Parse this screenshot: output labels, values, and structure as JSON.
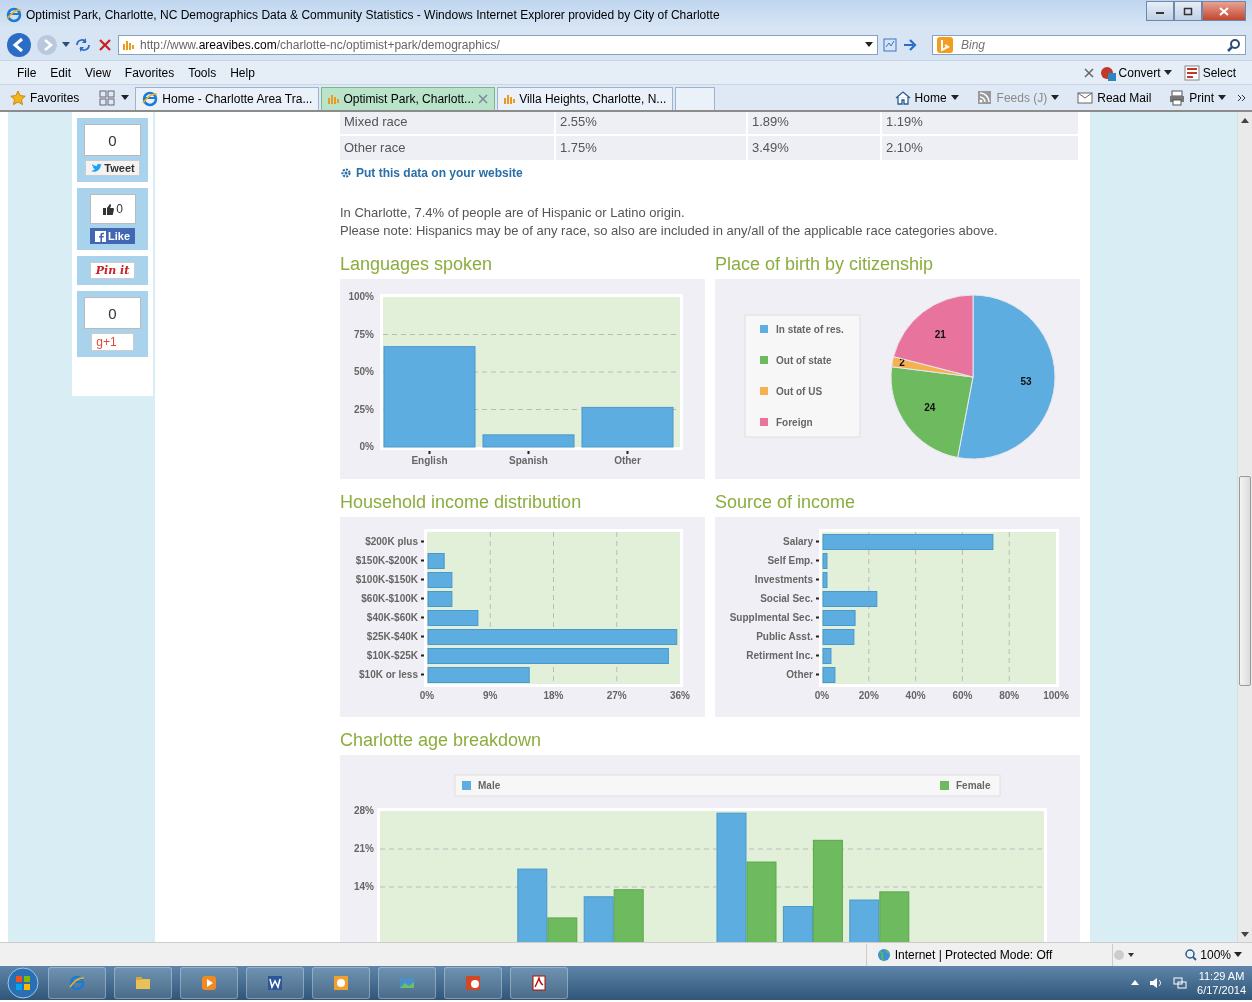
{
  "window": {
    "title": "Optimist Park, Charlotte, NC Demographics Data & Community Statistics - Windows Internet Explorer provided by City of Charlotte"
  },
  "address_bar": {
    "url_prefix": "http://www.",
    "url_domain": "areavibes.com",
    "url_path": "/charlotte-nc/optimist+park/demographics/"
  },
  "search": {
    "placeholder": "Bing"
  },
  "menu": [
    "File",
    "Edit",
    "View",
    "Favorites",
    "Tools",
    "Help"
  ],
  "command_bar": [
    "Convert",
    "Select"
  ],
  "favorites_button": "Favorites",
  "tabs": [
    {
      "label": "Home - Charlotte Area Tra...",
      "selected": false
    },
    {
      "label": "Optimist Park, Charlott...",
      "selected": true
    },
    {
      "label": "Villa Heights, Charlotte, N...",
      "selected": false
    }
  ],
  "toolbar": [
    {
      "label": "Home",
      "disabled": false
    },
    {
      "label": "Feeds (J)",
      "disabled": true
    },
    {
      "label": "Read Mail",
      "disabled": false
    },
    {
      "label": "Print",
      "disabled": false
    }
  ],
  "social": [
    {
      "kind": "tweet",
      "count": "0",
      "label": "Tweet"
    },
    {
      "kind": "like",
      "count": "0",
      "label": "Like"
    },
    {
      "kind": "pin",
      "label": "Pin it"
    },
    {
      "kind": "plusone",
      "count": "0",
      "label": "g+1"
    }
  ],
  "race_table": {
    "rows": [
      [
        "Mixed race",
        "2.55%",
        "1.89%",
        "1.19%"
      ],
      [
        "Other race",
        "1.75%",
        "3.49%",
        "2.10%"
      ]
    ]
  },
  "embed_link": "Put this data on your website",
  "notes": [
    "In Charlotte, 7.4% of people are of Hispanic or Latino origin.",
    "Please note: Hispanics may be of any race, so also are included in any/all of the applicable race categories above."
  ],
  "sections": [
    {
      "title": "Languages spoken",
      "kind": "half",
      "chart_data": {
        "type": "bar",
        "categories": [
          "English",
          "Spanish",
          "Other"
        ],
        "values": [
          66.9,
          8.1,
          26.4
        ],
        "grid": true,
        "ylim": [
          0,
          100
        ],
        "yticks": [
          {
            "value": 0,
            "label": "0%"
          },
          {
            "value": 25,
            "label": "25%"
          },
          {
            "value": 50,
            "label": "50%"
          },
          {
            "value": 75,
            "label": "75%"
          },
          {
            "value": 100,
            "label": "100%"
          }
        ]
      }
    },
    {
      "title": "Place of birth by citizenship",
      "kind": "half",
      "chart_data": {
        "type": "pie",
        "categories": [
          "In state of res.",
          "Out of state",
          "Out of US",
          "Foreign"
        ],
        "values": [
          53,
          24,
          2,
          21
        ],
        "colors": [
          "#5dade0",
          "#6dbb5e",
          "#f5b04f",
          "#e8739d"
        ],
        "legend": true,
        "data_labels": true
      }
    },
    {
      "title": "Household income distribution",
      "kind": "half",
      "chart_data": {
        "type": "bar",
        "orientation": "horizontal",
        "categories": [
          "$200K plus",
          "$150K-$200K",
          "$100K-$150K",
          "$60K-$100K",
          "$40K-$60K",
          "$25K-$40K",
          "$10K-$25K",
          "$10K or less"
        ],
        "values": [
          0,
          2.3,
          3.4,
          3.4,
          7.1,
          35.4,
          34.2,
          14.4
        ],
        "grid": true,
        "xlim": [
          0,
          36
        ],
        "xticks": [
          {
            "value": 0,
            "label": "0%"
          },
          {
            "value": 9,
            "label": "9%"
          },
          {
            "value": 18,
            "label": "18%"
          },
          {
            "value": 27,
            "label": "27%"
          },
          {
            "value": 36,
            "label": "36%"
          }
        ]
      }
    },
    {
      "title": "Source of income",
      "kind": "half",
      "chart_data": {
        "type": "bar",
        "orientation": "horizontal",
        "categories": [
          "Salary",
          "Self Emp.",
          "Investments",
          "Social Sec.",
          "Supplmental Sec.",
          "Public Asst.",
          "Retirment Inc.",
          "Other"
        ],
        "values": [
          72.6,
          1.7,
          1.7,
          23,
          13.7,
          13.2,
          3.4,
          5.1
        ],
        "grid": true,
        "xlim": [
          0,
          100
        ],
        "xticks": [
          {
            "value": 0,
            "label": "0%"
          },
          {
            "value": 20,
            "label": "20%"
          },
          {
            "value": 40,
            "label": "40%"
          },
          {
            "value": 60,
            "label": "60%"
          },
          {
            "value": 80,
            "label": "80%"
          },
          {
            "value": 100,
            "label": "100%"
          }
        ]
      }
    },
    {
      "title": "Charlotte age breakdown",
      "kind": "full",
      "chart_data": {
        "type": "bar",
        "series": [
          {
            "name": "Male",
            "color": "#5dade0",
            "values": [
              0,
              0,
              17.3,
              12.2,
              0,
              27.6,
              10.4,
              11.6,
              0,
              0
            ]
          },
          {
            "name": "Female",
            "color": "#6dbb5e",
            "values": [
              0,
              0,
              8.3,
              13.5,
              0,
              18.6,
              22.6,
              13.1,
              0,
              0
            ]
          }
        ],
        "legend": true,
        "grid": true,
        "ylim": [
          0,
          28
        ],
        "yticks": [
          {
            "value": 14,
            "label": "14%"
          },
          {
            "value": 21,
            "label": "21%"
          },
          {
            "value": 28,
            "label": "28%"
          }
        ]
      }
    }
  ],
  "status_bar": {
    "zone": "Internet | Protected Mode: Off",
    "zoom": "100%"
  },
  "taskbar": {
    "time": "11:29 AM",
    "date": "6/17/2014"
  }
}
